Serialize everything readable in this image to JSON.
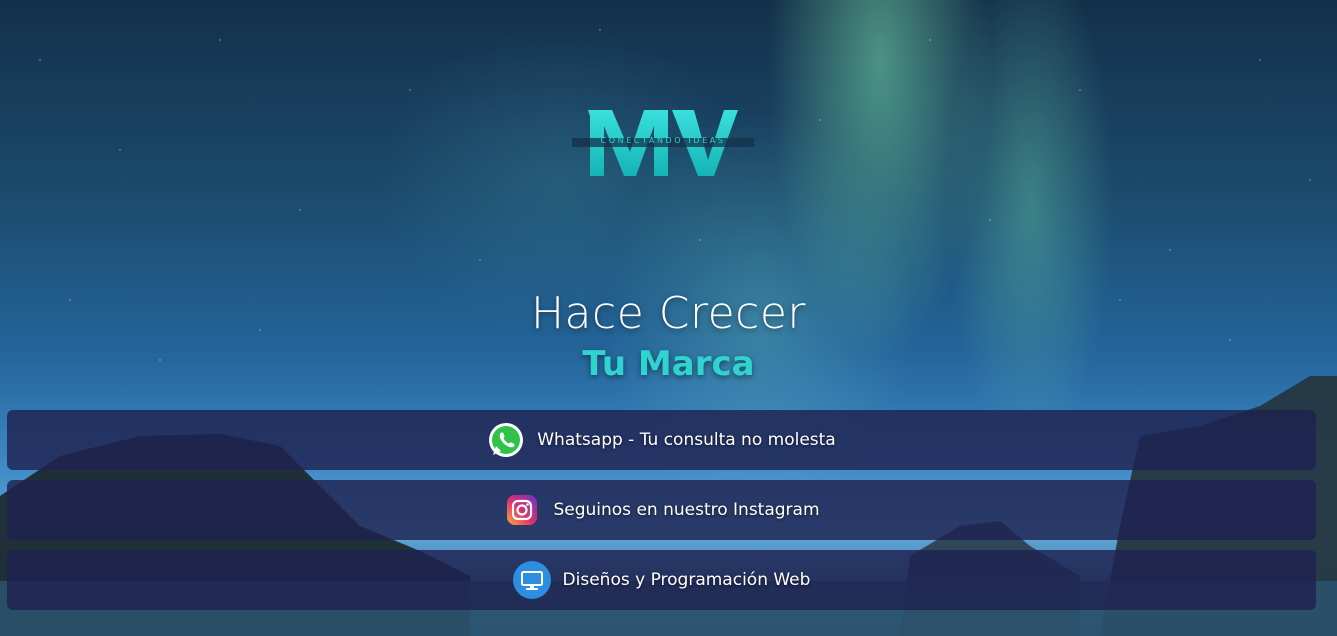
{
  "brand": {
    "logo_letters": "MV",
    "logo_tagline": "CONECTANDO IDEAS",
    "accent_color": "#2fd3cf"
  },
  "hero": {
    "headline": "Hace Crecer",
    "subheadline": "Tu Marca"
  },
  "links": [
    {
      "label": "Whatsapp - Tu consulta no molesta",
      "icon": "whatsapp-icon"
    },
    {
      "label": "Seguinos en nuestro Instagram",
      "icon": "instagram-icon"
    },
    {
      "label": "Diseños y Programación Web",
      "icon": "monitor-icon"
    }
  ]
}
